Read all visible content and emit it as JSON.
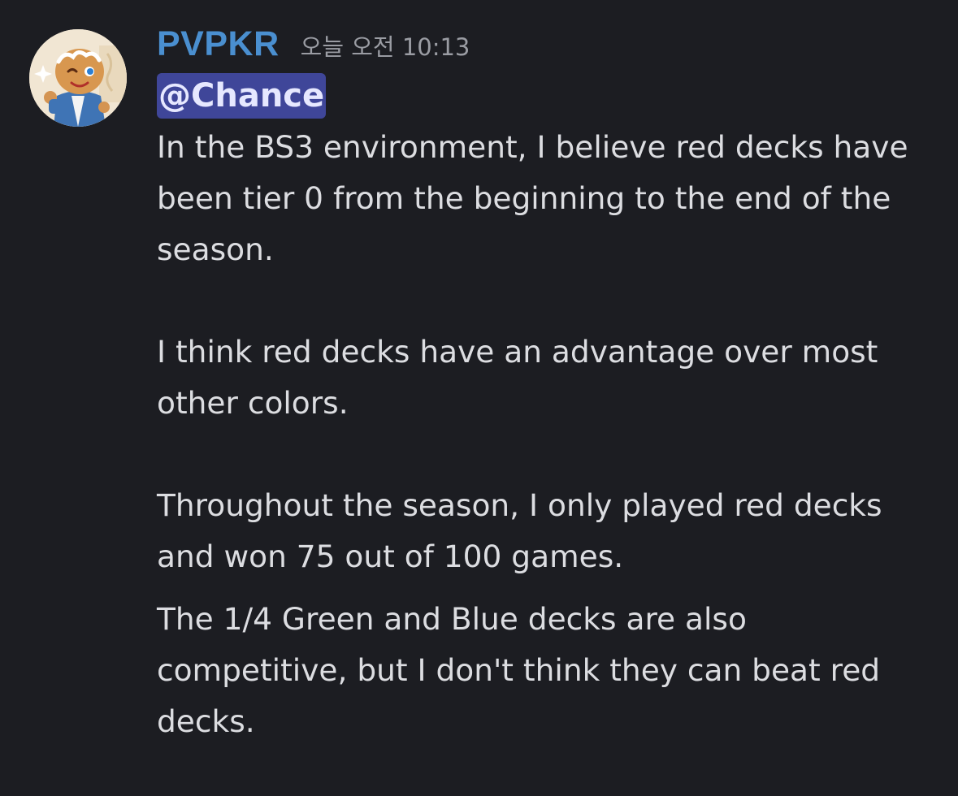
{
  "message": {
    "author": "PVPKR",
    "timestamp": "오늘 오전 10:13",
    "mention": "@Chance",
    "paragraphs": [
      "In the BS3 environment, I believe red decks have been tier 0 from the beginning to the end of the season.",
      "I think red decks have an advantage over most other colors.",
      "Throughout the season, I only played red decks and won 75 out of 100 games.",
      "The 1/4 Green and Blue decks are also competitive, but I don't think they can beat red decks."
    ]
  },
  "colors": {
    "background": "#1c1d22",
    "username": "#4a8fd0",
    "mention_bg": "#3f4699",
    "text": "#dcdde1",
    "timestamp": "#9a9ca3"
  },
  "icons": {
    "avatar": "cookie-character-avatar"
  }
}
